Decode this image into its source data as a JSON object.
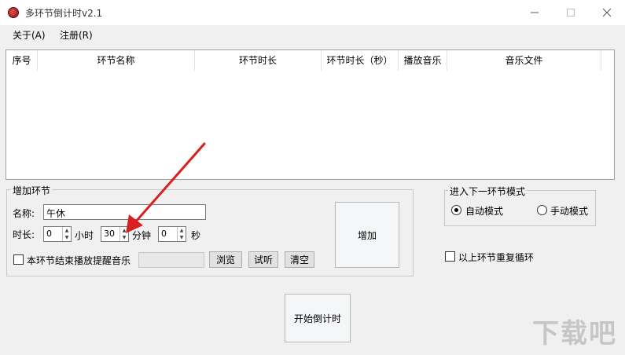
{
  "window": {
    "title": "多环节倒计时v2.1"
  },
  "menu": [
    {
      "label": "关于(A)"
    },
    {
      "label": "注册(R)"
    }
  ],
  "list": {
    "columns": [
      {
        "label": "序号"
      },
      {
        "label": "环节名称"
      },
      {
        "label": "环节时长"
      },
      {
        "label": "环节时长（秒）"
      },
      {
        "label": "播放音乐"
      },
      {
        "label": "音乐文件"
      }
    ]
  },
  "add_group": {
    "title": "增加环节",
    "name_label": "名称:",
    "name_value": "午休",
    "duration_label": "时长:",
    "hours_value": "0",
    "hours_unit": "小时",
    "minutes_value": "30",
    "minutes_unit": "分钟",
    "seconds_value": "0",
    "seconds_unit": "秒",
    "play_music_label": "本环节结束播放提醒音乐",
    "browse_label": "浏览",
    "preview_label": "试听",
    "clear_label": "清空",
    "add_label": "增加"
  },
  "mode_group": {
    "title": "进入下一环节模式",
    "auto_label": "自动模式",
    "manual_label": "手动模式"
  },
  "repeat_label": "以上环节重复循环",
  "start_label": "开始倒计时",
  "watermark": "下载吧"
}
